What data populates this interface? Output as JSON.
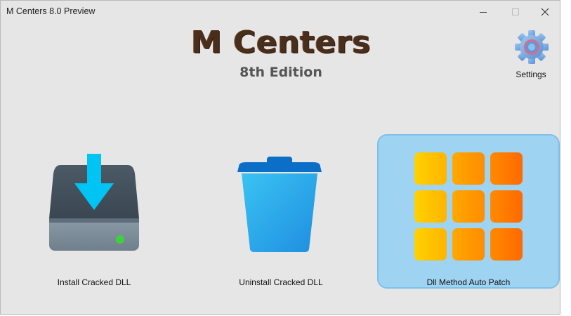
{
  "window": {
    "title": "M Centers 8.0 Preview"
  },
  "header": {
    "app_name": "M Centers",
    "edition": "8th Edition"
  },
  "settings": {
    "label": "Settings",
    "icon": "gear-icon"
  },
  "actions": [
    {
      "label": "Install Cracked DLL",
      "icon": "drive-download-icon",
      "selected": false
    },
    {
      "label": "Uninstall Cracked DLL",
      "icon": "trash-bin-icon",
      "selected": false
    },
    {
      "label": "Dll Method Auto Patch",
      "icon": "grid-apps-icon",
      "selected": true
    }
  ],
  "colors": {
    "background": "#e6e6e6",
    "selected_tile": "#9fd3f2",
    "brand_text": "#4a2e1c"
  }
}
